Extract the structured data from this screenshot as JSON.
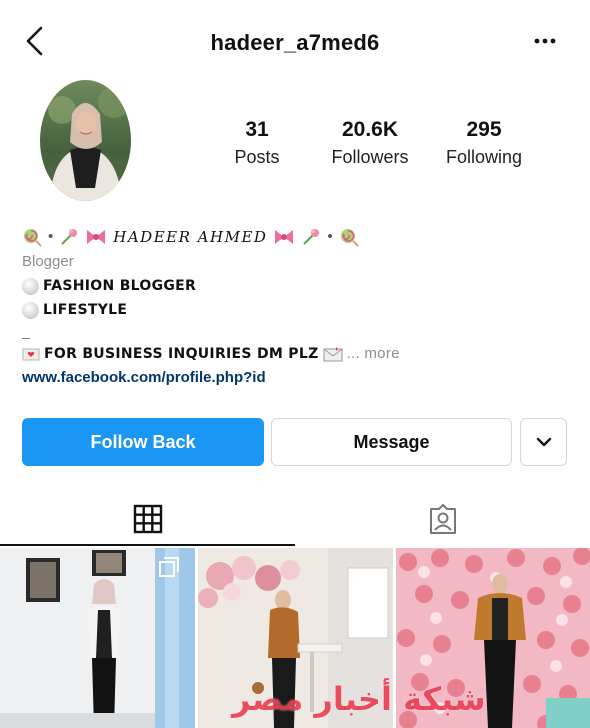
{
  "header": {
    "username": "hadeer_a7med6",
    "back_icon": "chevron-left-icon",
    "more_icon": "more-horizontal-icon"
  },
  "profile": {
    "avatar_icon": "profile-avatar",
    "stats": [
      {
        "value": "31",
        "label": "Posts"
      },
      {
        "value": "20.6K",
        "label": "Followers"
      },
      {
        "value": "295",
        "label": "Following"
      }
    ]
  },
  "bio": {
    "display_name": "HADEER AHMED",
    "category": "Blogger",
    "line1": "FASHION BLOGGER",
    "line2": "LIFESTYLE",
    "dash": "_",
    "inquiry": "FOR BUSINESS INQUIRIES DM PLZ",
    "more": "... more",
    "link": "www.facebook.com/profile.php?id"
  },
  "actions": {
    "follow_back": "Follow Back",
    "message": "Message",
    "suggest_icon": "chevron-down-icon"
  },
  "tabs": {
    "grid_icon": "grid-icon",
    "tagged_icon": "tagged-person-icon"
  },
  "watermark": "شبكة أخبار مصر",
  "colors": {
    "primary": "#1a96f5",
    "link": "#00376b",
    "muted": "#8e8e8e"
  }
}
